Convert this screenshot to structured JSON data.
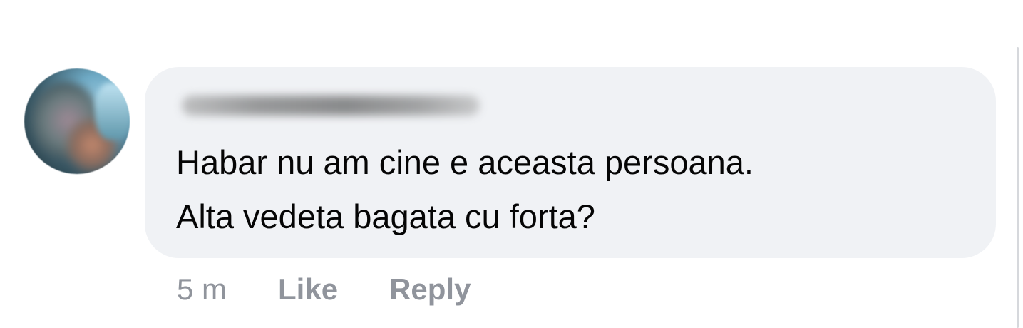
{
  "comment": {
    "author": "",
    "text_line1": "Habar nu am cine e aceasta persoana.",
    "text_line2": "Alta vedeta bagata cu forta?",
    "time": "5 m",
    "like_label": "Like",
    "reply_label": "Reply"
  },
  "colors": {
    "bubble": "#f0f2f5",
    "text": "#050505",
    "meta": "#90949c"
  }
}
